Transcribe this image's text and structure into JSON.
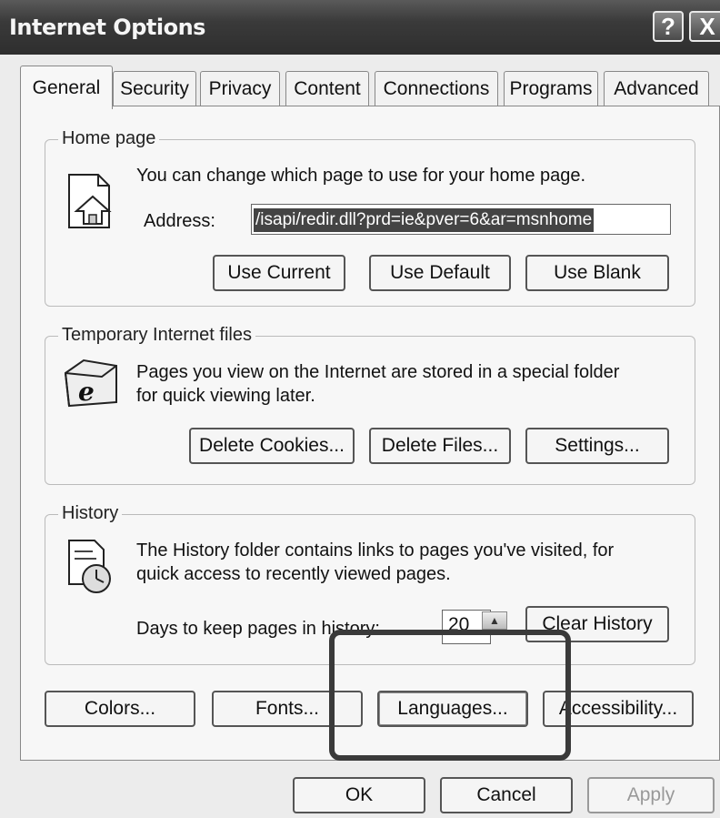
{
  "window": {
    "title": "Internet Options",
    "help_glyph": "?",
    "close_glyph": "X"
  },
  "tabs": [
    {
      "label": "General"
    },
    {
      "label": "Security"
    },
    {
      "label": "Privacy"
    },
    {
      "label": "Content"
    },
    {
      "label": "Connections"
    },
    {
      "label": "Programs"
    },
    {
      "label": "Advanced"
    }
  ],
  "home_page": {
    "group_label": "Home page",
    "description": "You can change which page to use for your home page.",
    "address_label": "Address:",
    "address_value": "/isapi/redir.dll?prd=ie&pver=6&ar=msnhome",
    "use_current": "Use Current",
    "use_default": "Use Default",
    "use_blank": "Use Blank",
    "icon": "home-page-icon"
  },
  "temp_files": {
    "group_label": "Temporary Internet files",
    "description_line1": "Pages you view on the Internet are stored in a special folder",
    "description_line2": "for quick viewing later.",
    "delete_cookies": "Delete Cookies...",
    "delete_files": "Delete Files...",
    "settings": "Settings...",
    "icon": "ie-folder-icon"
  },
  "history": {
    "group_label": "History",
    "description_line1": "The History folder contains links to pages you've visited, for",
    "description_line2": "quick access to recently viewed pages.",
    "days_label": "Days to keep pages in history:",
    "days_value": "20",
    "clear_history": "Clear History",
    "icon": "history-clock-icon"
  },
  "bottom_buttons": {
    "colors": "Colors...",
    "fonts": "Fonts...",
    "languages": "Languages...",
    "accessibility": "Accessibility..."
  },
  "dialog_buttons": {
    "ok": "OK",
    "cancel": "Cancel",
    "apply": "Apply"
  }
}
